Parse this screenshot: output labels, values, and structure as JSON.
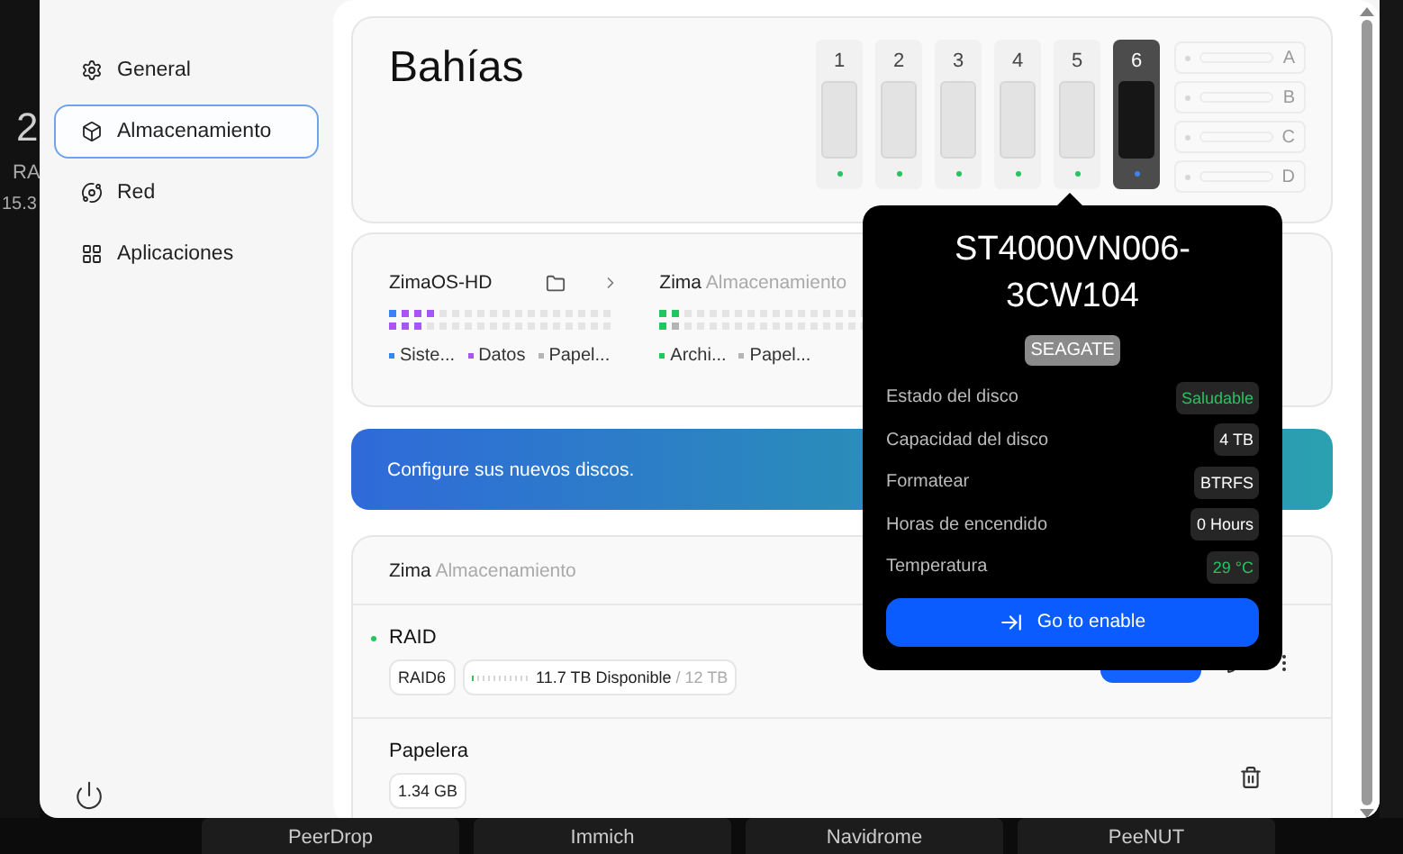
{
  "backdrop": {
    "gauge_value": "2",
    "gauge_label": "RA",
    "gauge_reading": "15.3",
    "dock": [
      {
        "label": "PeerDrop"
      },
      {
        "label": "Immich"
      },
      {
        "label": "Navidrome"
      },
      {
        "label": "PeeNUT"
      }
    ]
  },
  "sidebar": {
    "items": [
      {
        "label": "General",
        "selected": false
      },
      {
        "label": "Almacenamiento",
        "selected": true
      },
      {
        "label": "Red",
        "selected": false
      },
      {
        "label": "Aplicaciones",
        "selected": false
      }
    ]
  },
  "bays": {
    "title": "Bahías",
    "slots": [
      {
        "label": "1",
        "selected": false,
        "color": "#22c55e"
      },
      {
        "label": "2",
        "selected": false,
        "color": "#22c55e"
      },
      {
        "label": "3",
        "selected": false,
        "color": "#22c55e"
      },
      {
        "label": "4",
        "selected": false,
        "color": "#22c55e"
      },
      {
        "label": "5",
        "selected": false,
        "color": "#22c55e"
      },
      {
        "label": "6",
        "selected": true,
        "color": "#3b82f6"
      }
    ],
    "m2_slots": [
      {
        "label": "A"
      },
      {
        "label": "B"
      },
      {
        "label": "C"
      },
      {
        "label": "D"
      }
    ]
  },
  "storage_groups": [
    {
      "name": "ZimaOS-HD",
      "legend": [
        {
          "label": "Siste...",
          "color": "#3b82f6"
        },
        {
          "label": "Datos",
          "color": "#a855f7"
        },
        {
          "label": "Papel...",
          "color": "#b5b5b5"
        }
      ]
    },
    {
      "name": "Zima",
      "subtitle": "Almacenamiento",
      "legend": [
        {
          "label": "Archi...",
          "color": "#22c55e"
        },
        {
          "label": "Papel...",
          "color": "#b5b5b5"
        }
      ]
    }
  ],
  "banner": {
    "text": "Configure sus nuevos discos."
  },
  "pool": {
    "name": "Zima",
    "subtitle": "Almacenamiento",
    "raid": {
      "name": "RAID",
      "type": "RAID6",
      "available": "11.7 TB Disponible",
      "total": "/ 12 TB",
      "level": 0.03
    },
    "trash": {
      "name": "Papelera",
      "size": "1.34 GB"
    }
  },
  "disk_popover": {
    "model": "ST4000VN006-3CW104",
    "brand": "SEAGATE",
    "rows": [
      {
        "label": "Estado del disco",
        "value": "Saludable",
        "kind": "good"
      },
      {
        "label": "Capacidad del disco",
        "value": "4 TB",
        "kind": "plain"
      },
      {
        "label": "Formatear",
        "value": "BTRFS",
        "kind": "plain"
      },
      {
        "label": "Horas de encendido",
        "value": "0 Hours",
        "kind": "plain"
      },
      {
        "label": "Temperatura",
        "value": "29 °C",
        "kind": "good"
      }
    ],
    "button": "Go to enable"
  }
}
